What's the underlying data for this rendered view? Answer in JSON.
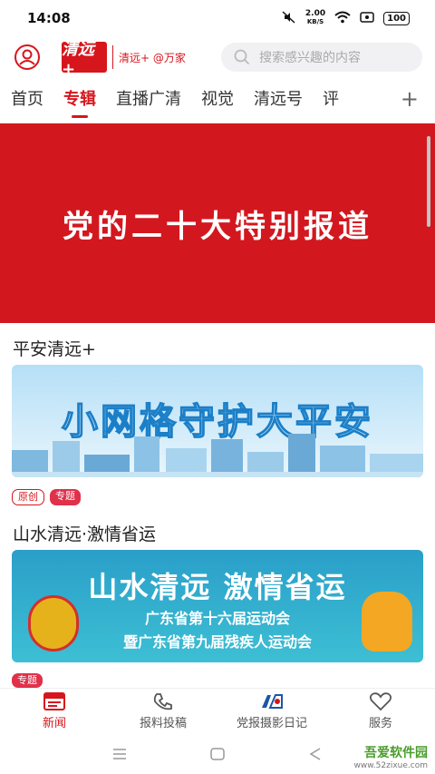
{
  "status_bar": {
    "time": "14:08",
    "net_speed_value": "2.00",
    "net_speed_unit": "KB/S",
    "battery": "100"
  },
  "header": {
    "logo_mark": "清远+",
    "logo_text": "清远+ @万家",
    "search_placeholder": "搜索感兴趣的内容"
  },
  "tabs": [
    {
      "label": "首页",
      "active": false
    },
    {
      "label": "专辑",
      "active": true
    },
    {
      "label": "直播广清",
      "active": false
    },
    {
      "label": "视觉",
      "active": false
    },
    {
      "label": "清远号",
      "active": false
    },
    {
      "label": "评",
      "active": false
    }
  ],
  "tab_more": "+",
  "banner": {
    "text": "党的二十大特别报道"
  },
  "sections": [
    {
      "title": "平安清远+",
      "card_title": "小网格守护大平安",
      "tags": [
        "原创",
        "专题"
      ]
    },
    {
      "title": "山水清远·激情省运",
      "card_title": "山水清远  激情省运",
      "card_line1": "广东省第十六届运动会",
      "card_line2": "暨广东省第九届残疾人运动会",
      "tags": [
        "专题"
      ]
    }
  ],
  "bottom_nav": [
    {
      "label": "新闻",
      "active": true
    },
    {
      "label": "报料投稿",
      "active": false
    },
    {
      "label": "党报摄影日记",
      "active": false
    },
    {
      "label": "服务",
      "active": false
    }
  ],
  "watermark": {
    "brand": "吾爱软件园",
    "url": "www.52zixue.com"
  },
  "colors": {
    "accent": "#d6161c",
    "banner_red": "#d3171f"
  }
}
